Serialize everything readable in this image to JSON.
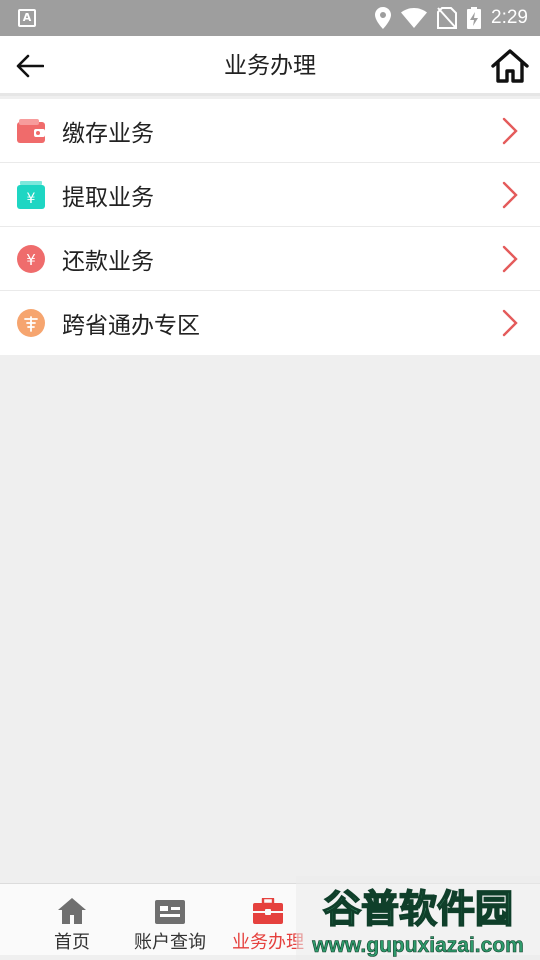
{
  "status_bar": {
    "time": "2:29"
  },
  "nav": {
    "title": "业务办理"
  },
  "menu_items": [
    {
      "label": "缴存业务",
      "icon": "wallet-icon",
      "color": "#f06b6b"
    },
    {
      "label": "提取业务",
      "icon": "withdraw-icon",
      "color": "#1ed6c3"
    },
    {
      "label": "还款业务",
      "icon": "repay-icon",
      "color": "#ef6c6c"
    },
    {
      "label": "跨省通办专区",
      "icon": "loan-icon",
      "color": "#f6a56f"
    }
  ],
  "tabs": [
    {
      "label": "首页",
      "icon": "home-icon"
    },
    {
      "label": "账户查询",
      "icon": "id-card-icon"
    },
    {
      "label": "业务办理",
      "icon": "briefcase-icon",
      "active": true
    },
    {
      "label": "",
      "icon": "hidden-icon"
    },
    {
      "label": "",
      "icon": "hidden-icon"
    }
  ],
  "watermark": {
    "brand": "谷普软件园",
    "url": "www.gupuxiazai.com"
  },
  "colors": {
    "accent": "#e5413e",
    "status_bar": "#9e9e9e",
    "background": "#efefef"
  }
}
